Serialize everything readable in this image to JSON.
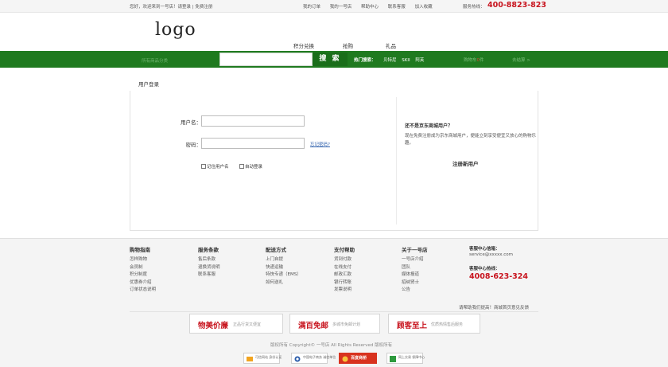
{
  "topbar": {
    "greeting": "您好，欢迎来到一号店！请登录 | 免费注册",
    "links": [
      "我的订单",
      "我的一号店",
      "帮助中心",
      "联系客服",
      "加入收藏"
    ],
    "hotline_label": "服务热线：",
    "hotline_number": "400-8823-823"
  },
  "header": {
    "logo": "logo",
    "nav": [
      "积分兑换",
      "抢购",
      "礼品"
    ]
  },
  "searchbar": {
    "category_hint": "所有商品分类",
    "search_placeholder": "",
    "search_button": "搜 索",
    "hot_label": "热门搜索：",
    "hot_words": [
      "贝特尼",
      "SKII",
      "阿芙"
    ],
    "cart_text": "购物车",
    "cart_count": "0",
    "cart_suffix": "件",
    "checkout": "去结算 >"
  },
  "login": {
    "section_title": "用户登录",
    "username_label": "用户名：",
    "username_value": "",
    "password_label": "密码：",
    "password_value": "",
    "forgot_password": "忘记密码?",
    "remember_username": "记住用户名",
    "auto_login": "自动登录"
  },
  "register": {
    "title": "还不是京东商城用户？",
    "text": "现在免费注册成为京东商城用户，便能立刻享受便宜又放心的购物乐趣。",
    "button": "注册新用户"
  },
  "footer": {
    "columns": [
      {
        "title": "购物指南",
        "items": [
          "怎样购物",
          "会员制",
          "积分制度",
          "优惠券介绍",
          "订单状态说明"
        ]
      },
      {
        "title": "服务条款",
        "items": [
          "售后条款",
          "退换货说明",
          "联系客服"
        ]
      },
      {
        "title": "配送方式",
        "items": [
          "上门自提",
          "快递运输",
          "特快专递（EMS）",
          "如何送礼"
        ]
      },
      {
        "title": "支付帮助",
        "items": [
          "货到付款",
          "在线支付",
          "邮政汇款",
          "银行转账",
          "发票说明"
        ]
      },
      {
        "title": "关于一号店",
        "items": [
          "一号店介绍",
          "团队",
          "媒体报道",
          "招纳贤士",
          "公告"
        ]
      }
    ],
    "service": {
      "email_label": "客服中心信箱：",
      "email": "service@xxxxx.com",
      "phone_label": "客服中心热线：",
      "phone": "4008-623-324"
    },
    "feedback": "请帮助我们提高！商城首页意见反馈",
    "promos": [
      {
        "big": "物美价廉",
        "small": "正品行货又便宜"
      },
      {
        "big": "满百免邮",
        "small": "多城市免邮计划"
      },
      {
        "big": "顾客至上",
        "small": "优质热情售后服务"
      }
    ],
    "copyright": "版权所有 Copyright© 一号店 All Rights Reserved 版权所有",
    "badges": [
      {
        "label": "可信网站 身份认证"
      },
      {
        "label": "中国电子商务 诚信单位"
      },
      {
        "label": "百度商桥"
      },
      {
        "label": "网上交易 保障中心"
      }
    ]
  },
  "colors": {
    "brand_green": "#1f7a1f",
    "accent_red": "#c8141e"
  }
}
